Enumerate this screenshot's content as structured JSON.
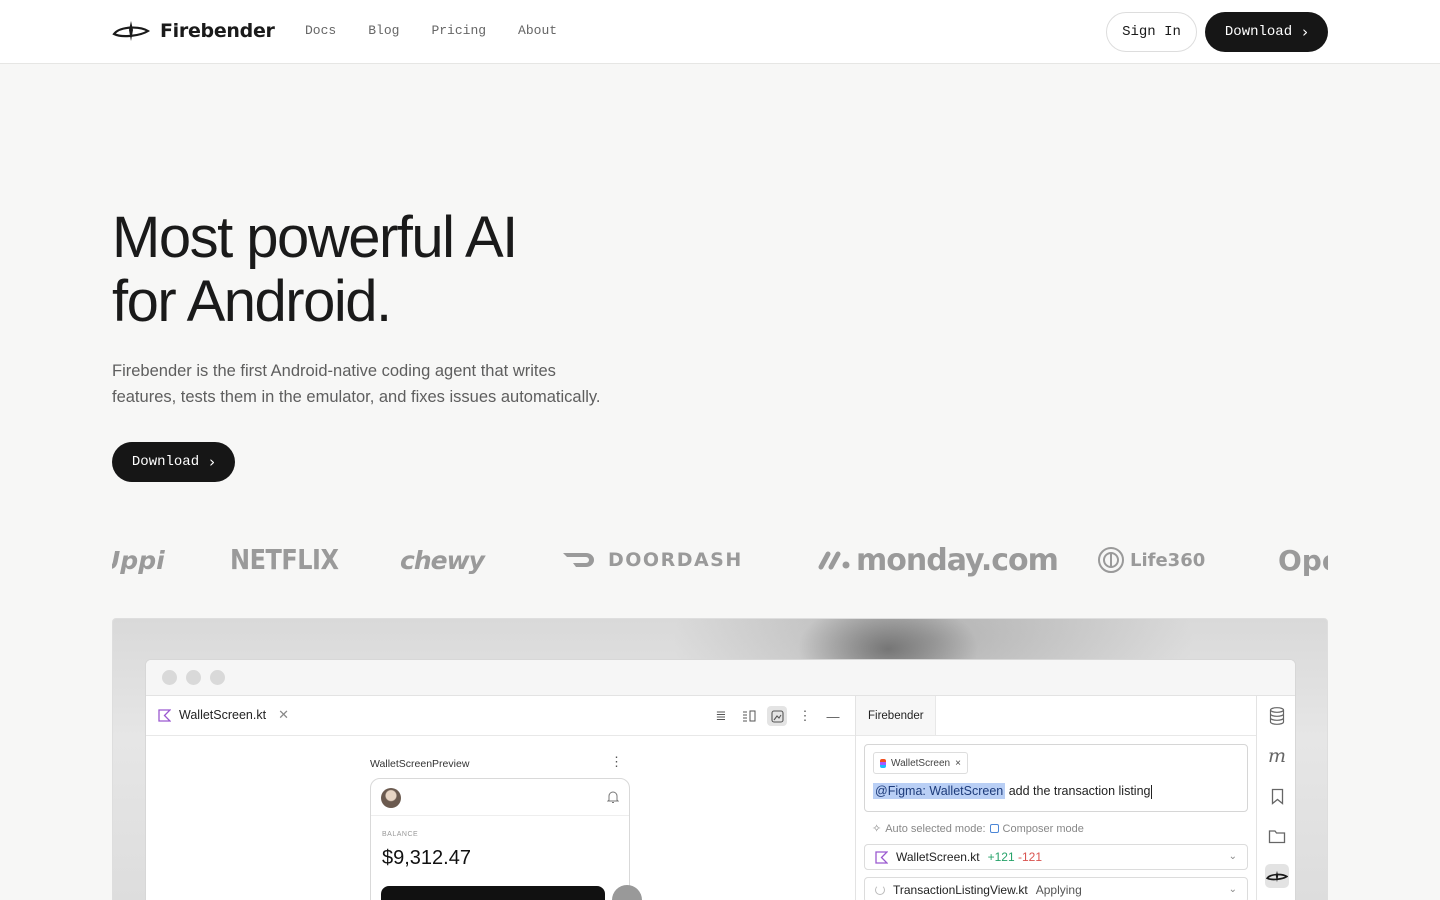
{
  "brand": {
    "name": "Firebender"
  },
  "nav": {
    "links": [
      "Docs",
      "Blog",
      "Pricing",
      "About"
    ],
    "sign_in": "Sign In",
    "download": "Download"
  },
  "hero": {
    "title_line1": "Most powerful AI",
    "title_line2": "for Android.",
    "subtitle_line1": "Firebender is the first Android-native coding agent that writes",
    "subtitle_line2": "features, tests them in the emulator, and fixes issues automatically.",
    "cta": "Download"
  },
  "logos": [
    "Uppi",
    "NETFLIX",
    "chewy",
    "DOORDASH",
    "monday.com",
    "Life360",
    "Ope"
  ],
  "ide": {
    "file_tab": "WalletScreen.kt",
    "preview_label": "WalletScreenPreview",
    "balance_label": "BALANCE",
    "balance_value": "$9,312.47",
    "agent_tab": "Firebender",
    "chip_label": "WalletScreen",
    "mention": "@Figma: WalletScreen",
    "prompt_text": " add the transaction listing",
    "mode_prefix": "Auto selected mode:",
    "mode_value": "Composer mode",
    "file1_name": "WalletScreen.kt",
    "file1_added": "+121",
    "file1_removed": "-121",
    "file2_name": "TransactionListingView.kt",
    "file2_status": "Applying"
  }
}
